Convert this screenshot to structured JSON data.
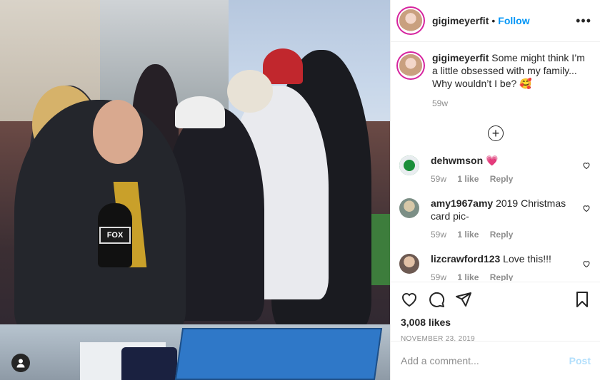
{
  "post": {
    "username": "gigimeyerfit",
    "follow_label": "Follow",
    "more_label": "•••",
    "photo_mic_label": "FOX"
  },
  "caption": {
    "username": "gigimeyerfit",
    "text": "Some might think I’m a little obsessed with my family... Why wouldn’t I be? 🥰",
    "age": "59w"
  },
  "comments": [
    {
      "username": "dehwmson",
      "text": "💗",
      "age": "59w",
      "likes": "1 like",
      "reply": "Reply",
      "avatar_color": "#1a8f3a"
    },
    {
      "username": "amy1967amy",
      "text": "2019 Christmas card pic-",
      "age": "59w",
      "likes": "1 like",
      "reply": "Reply",
      "avatar_color": "#9aa3a1"
    },
    {
      "username": "lizcrawford123",
      "text": "Love this!!!",
      "age": "59w",
      "likes": "1 like",
      "reply": "Reply",
      "avatar_color": "#7b6a61"
    }
  ],
  "engagement": {
    "likes": "3,008 likes",
    "date": "NOVEMBER 23, 2019"
  },
  "add_comment": {
    "placeholder": "Add a comment...",
    "post_label": "Post"
  },
  "colors": {
    "link_blue": "#0095f6",
    "post_disabled": "#b2dffc",
    "muted": "#8e8e8e"
  }
}
